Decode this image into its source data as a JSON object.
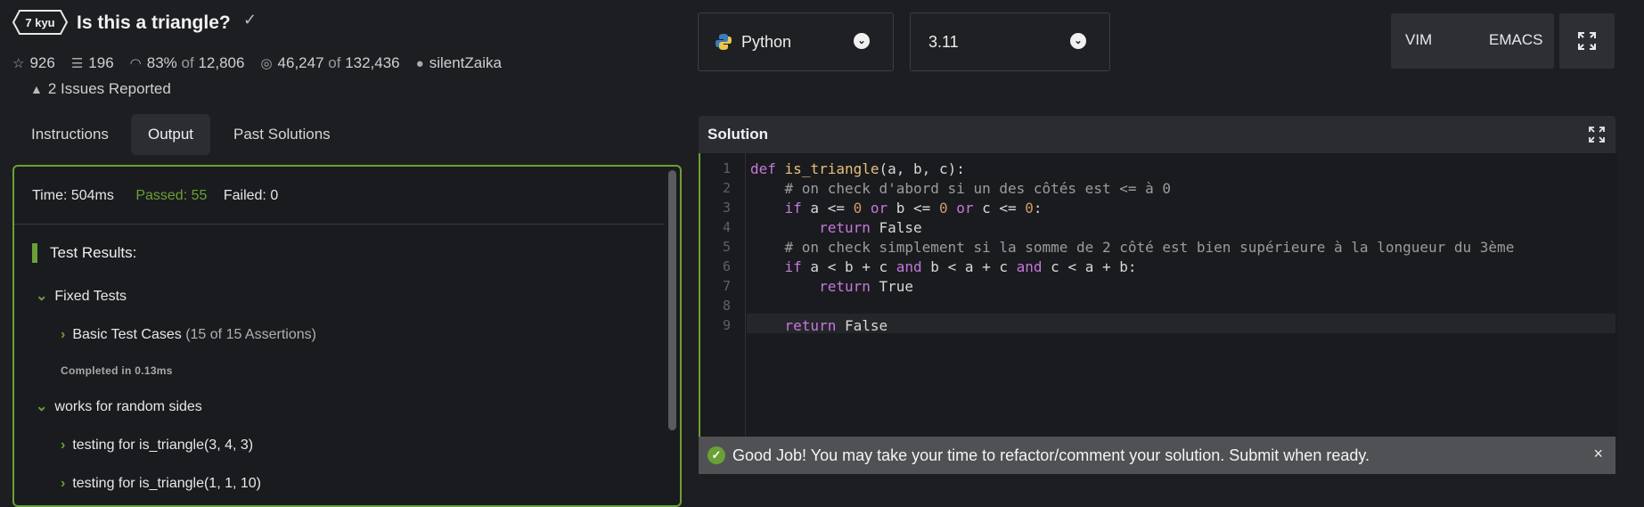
{
  "kata": {
    "rank": "7 kyu",
    "title": "Is this a triangle?",
    "stats": {
      "stars": "926",
      "collections": "196",
      "satisfaction_pct": "83%",
      "satisfaction_of": "of",
      "satisfaction_total": "12,806",
      "completed": "46,247",
      "completed_of": "of",
      "completed_total": "132,436",
      "author": "silentZaika"
    },
    "issues": "2 Issues Reported"
  },
  "tabs": [
    {
      "label": "Instructions"
    },
    {
      "label": "Output"
    },
    {
      "label": "Past Solutions"
    }
  ],
  "output": {
    "time": "Time: 504ms",
    "passed": "Passed: 55",
    "failed": "Failed: 0",
    "results_title": "Test Results:",
    "groups": {
      "fixed": "Fixed Tests",
      "basic": "Basic Test Cases",
      "basic_count": "(15 of 15 Assertions)",
      "completed": "Completed in 0.13ms",
      "random": "works for random sides",
      "t1": "testing for is_triangle(3, 4, 3)",
      "t2": "testing for is_triangle(1, 1, 10)"
    }
  },
  "language_select": {
    "value": "Python"
  },
  "version_select": {
    "value": "3.11"
  },
  "modes": {
    "vim": "VIM",
    "emacs": "EMACS"
  },
  "solution": {
    "title": "Solution",
    "line_numbers": [
      "1",
      "2",
      "3",
      "4",
      "5",
      "6",
      "7",
      "8",
      "9"
    ]
  },
  "banner": {
    "message": "Good Job! You may take your time to refactor/comment your solution. Submit when ready.",
    "close": "×"
  },
  "colors": {
    "accent": "#6aa136",
    "background": "#1d1e22"
  }
}
